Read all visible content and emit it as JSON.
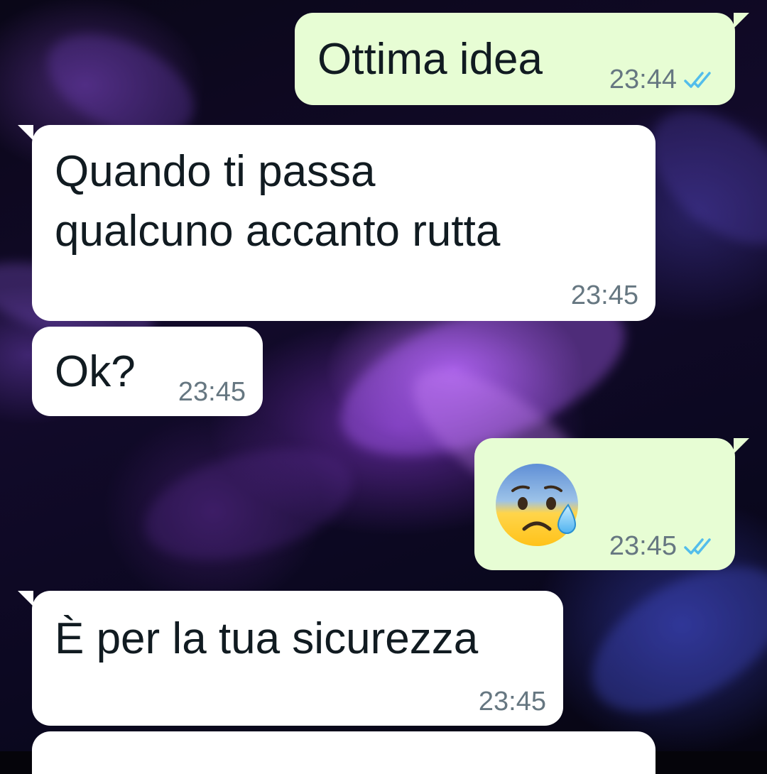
{
  "messages": [
    {
      "direction": "outgoing",
      "text": "Ottima idea",
      "time": "23:44",
      "status": "read-double-check"
    },
    {
      "direction": "incoming",
      "text_lines": [
        "Quando ti passa",
        "qualcuno accanto rutta"
      ],
      "time": "23:45"
    },
    {
      "direction": "incoming",
      "text": "Ok?",
      "time": "23:45"
    },
    {
      "direction": "outgoing",
      "emoji": "anxious-face-with-sweat-emoji",
      "time": "23:45",
      "status": "read-double-check"
    },
    {
      "direction": "incoming",
      "text": "È per la tua sicurezza",
      "time": "23:45"
    }
  ],
  "colors": {
    "outgoing_bubble": "#e7fdd4",
    "incoming_bubble": "#ffffff",
    "read_ticks": "#53bdeb",
    "timestamp": "#667781"
  }
}
